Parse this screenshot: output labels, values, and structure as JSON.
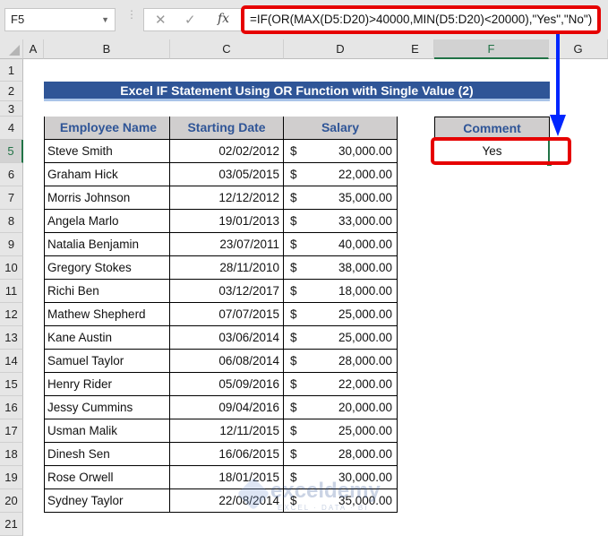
{
  "formula_bar": {
    "name_box": "F5",
    "cancel_icon": "✕",
    "enter_icon": "✓",
    "fx_label": "fx",
    "formula": "=IF(OR(MAX(D5:D20)>40000,MIN(D5:D20)<20000),\"Yes\",\"No\")"
  },
  "columns": [
    "A",
    "B",
    "C",
    "D",
    "E",
    "F",
    "G"
  ],
  "selected_column": "F",
  "rows": [
    "1",
    "2",
    "3",
    "4",
    "5",
    "6",
    "7",
    "8",
    "9",
    "10",
    "11",
    "12",
    "13",
    "14",
    "15",
    "16",
    "17",
    "18",
    "19",
    "20",
    "21"
  ],
  "selected_row": "5",
  "title": "Excel IF Statement Using OR Function with Single Value (2)",
  "table": {
    "headers": [
      "Employee Name",
      "Starting Date",
      "Salary"
    ],
    "currency_symbol": "$",
    "rows": [
      {
        "name": "Steve Smith",
        "date": "02/02/2012",
        "salary": "30,000.00"
      },
      {
        "name": "Graham Hick",
        "date": "03/05/2015",
        "salary": "22,000.00"
      },
      {
        "name": "Morris Johnson",
        "date": "12/12/2012",
        "salary": "35,000.00"
      },
      {
        "name": "Angela Marlo",
        "date": "19/01/2013",
        "salary": "33,000.00"
      },
      {
        "name": "Natalia Benjamin",
        "date": "23/07/2011",
        "salary": "40,000.00"
      },
      {
        "name": "Gregory Stokes",
        "date": "28/11/2010",
        "salary": "38,000.00"
      },
      {
        "name": "Richi Ben",
        "date": "03/12/2017",
        "salary": "18,000.00"
      },
      {
        "name": "Mathew Shepherd",
        "date": "07/07/2015",
        "salary": "25,000.00"
      },
      {
        "name": "Kane Austin",
        "date": "03/06/2014",
        "salary": "25,000.00"
      },
      {
        "name": "Samuel Taylor",
        "date": "06/08/2014",
        "salary": "28,000.00"
      },
      {
        "name": "Henry Rider",
        "date": "05/09/2016",
        "salary": "22,000.00"
      },
      {
        "name": "Jessy Cummins",
        "date": "09/04/2016",
        "salary": "20,000.00"
      },
      {
        "name": "Usman Malik",
        "date": "12/11/2015",
        "salary": "25,000.00"
      },
      {
        "name": "Dinesh Sen",
        "date": "16/06/2015",
        "salary": "28,000.00"
      },
      {
        "name": "Rose Orwell",
        "date": "18/01/2015",
        "salary": "30,000.00"
      },
      {
        "name": "Sydney Taylor",
        "date": "22/08/2014",
        "salary": "35,000.00"
      }
    ]
  },
  "comment": {
    "header": "Comment",
    "value": "Yes"
  },
  "watermark": {
    "brand": "exceldemy",
    "tagline": "EXCEL · DATA · BI"
  },
  "colors": {
    "title_bg": "#2f5597",
    "header_bg": "#d0cece",
    "header_text": "#2f5597",
    "highlight_red": "#e60000",
    "arrow_blue": "#0026ff",
    "selection_green": "#217346"
  }
}
